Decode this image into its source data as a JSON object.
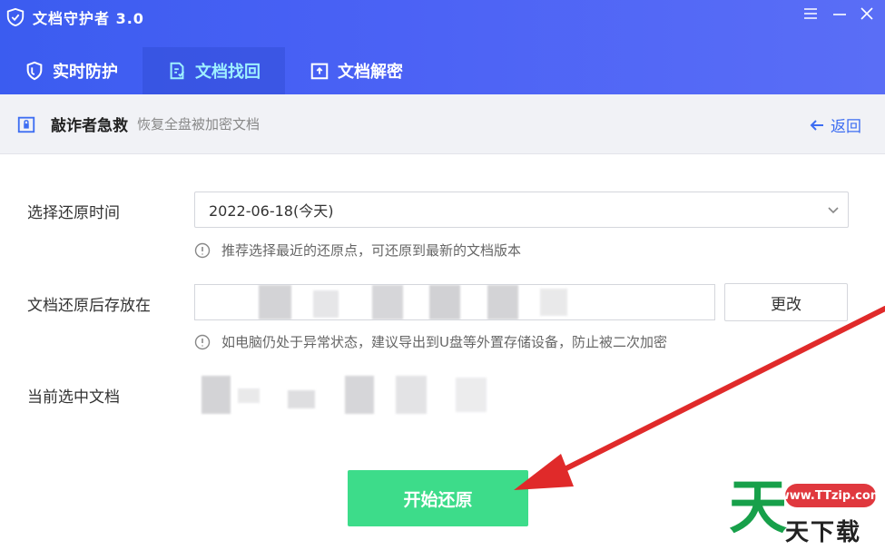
{
  "app": {
    "title": "文档守护者 3.0"
  },
  "tabs": [
    {
      "label": "实时防护",
      "icon": "shield-icon"
    },
    {
      "label": "文档找回",
      "icon": "document-recover-icon",
      "active": true
    },
    {
      "label": "文档解密",
      "icon": "unlock-box-icon"
    }
  ],
  "header": {
    "title": "敲诈者急救",
    "subtitle": "恢复全盘被加密文档",
    "back_label": "返回"
  },
  "form": {
    "restore_time_label": "选择还原时间",
    "restore_time_value": "2022-06-18(今天)",
    "restore_time_hint": "推荐选择最近的还原点，可还原到最新的文档版本",
    "save_location_label": "文档还原后存放在",
    "change_button_label": "更改",
    "save_location_hint": "如电脑仍处于异常状态，建议导出到U盘等外置存储设备，防止被二次加密",
    "current_doc_label": "当前选中文档"
  },
  "actions": {
    "start_label": "开始还原"
  },
  "watermark": {
    "url": "www.TTzip.com",
    "big_char": "天",
    "text": "天下载"
  },
  "colors": {
    "title_bar": "#4b62f5",
    "active_tab_text": "#9ef0ff",
    "link_blue": "#3d6df2",
    "start_button": "#3ddc8a",
    "annotation_arrow": "#e02a2a"
  }
}
